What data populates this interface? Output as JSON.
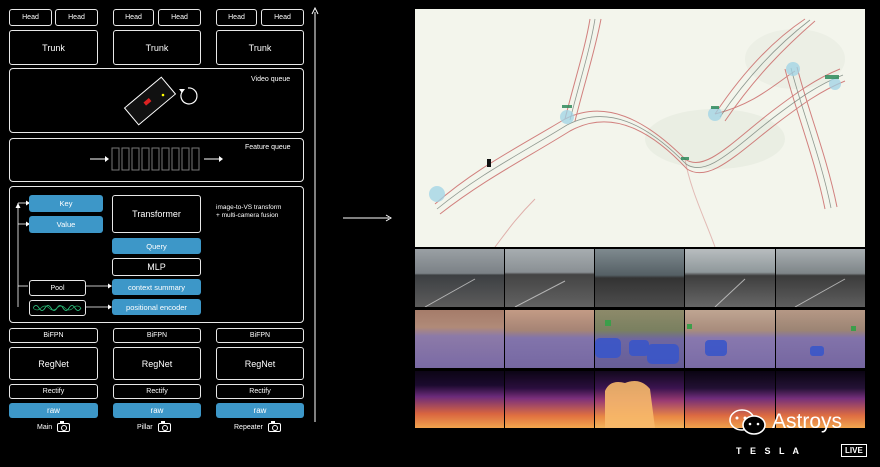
{
  "columns": [
    {
      "head1": "Head",
      "head2": "Head",
      "trunk": "Trunk",
      "bifpn": "BiFPN",
      "regnet": "RegNet",
      "rectify": "Rectify",
      "raw": "raw",
      "camera": "Main"
    },
    {
      "head1": "Head",
      "head2": "Head",
      "trunk": "Trunk",
      "bifpn": "BiFPN",
      "regnet": "RegNet",
      "rectify": "Rectify",
      "raw": "raw",
      "camera": "Pillar"
    },
    {
      "head1": "Head",
      "head2": "Head",
      "trunk": "Trunk",
      "bifpn": "BiFPN",
      "regnet": "RegNet",
      "rectify": "Rectify",
      "raw": "raw",
      "camera": "Repeater"
    }
  ],
  "video_queue": "Video queue",
  "feature_queue": "Feature queue",
  "fusion": {
    "key": "Key",
    "value": "Value",
    "transformer": "Transformer",
    "query": "Query",
    "mlp": "MLP",
    "pool": "Pool",
    "context_summary": "context summary",
    "positional_encoder": "positional encoder",
    "caption_line1": "image-to-VS transform",
    "caption_line2": "+ multi-camera fusion"
  },
  "watermark": {
    "brand": "Astroys",
    "tesla": "T E S L A",
    "live": "LIVE"
  },
  "colors": {
    "accent_blue": "#3d97c8",
    "background": "#000000",
    "bev_background": "#f3f5ec"
  }
}
